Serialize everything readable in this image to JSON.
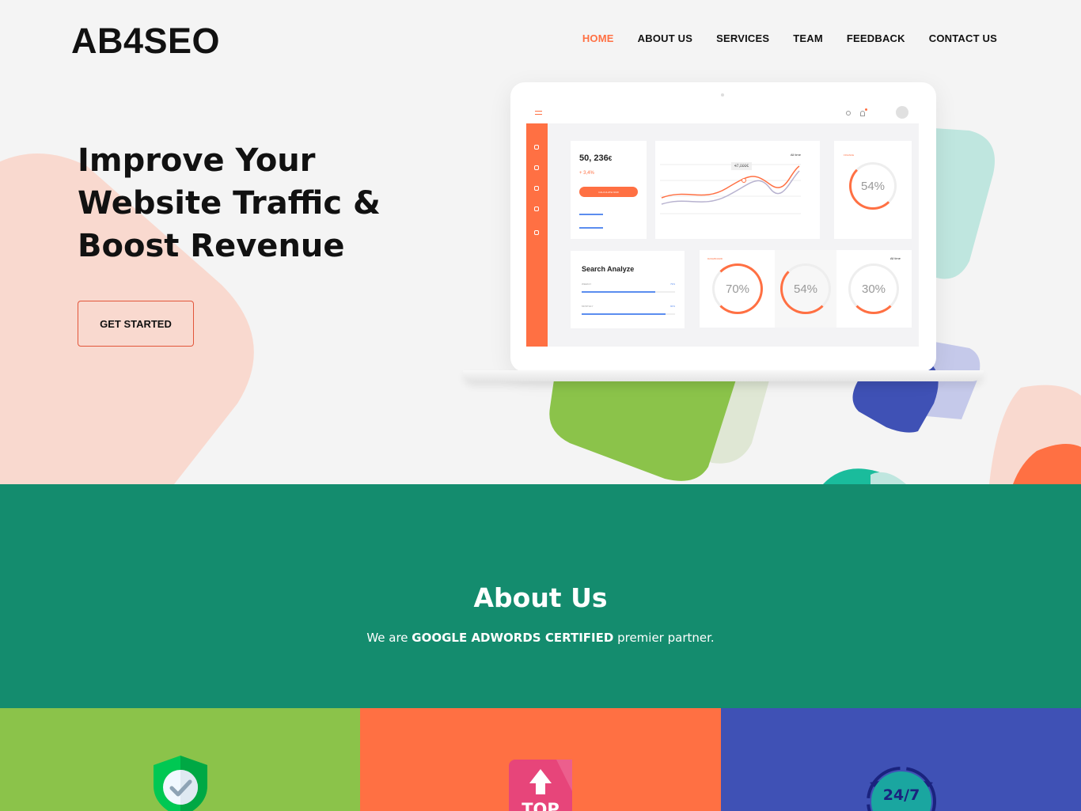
{
  "brand": {
    "logo": "AB4SEO"
  },
  "nav": {
    "items": [
      {
        "label": "HOME",
        "active": true
      },
      {
        "label": "ABOUT US",
        "active": false
      },
      {
        "label": "SERVICES",
        "active": false
      },
      {
        "label": "TEAM",
        "active": false
      },
      {
        "label": "FEEDBACK",
        "active": false
      },
      {
        "label": "CONTACT US",
        "active": false
      }
    ]
  },
  "hero": {
    "headline_lines": [
      "Improve Your",
      "Website Traffic &",
      "Boost Revenue"
    ],
    "cta_label": "GET STARTED"
  },
  "dashboard": {
    "revenue_value": "50, 236",
    "revenue_currency": "€",
    "revenue_change": "+ 3,4%",
    "calc_button": "CALCULATE NOW",
    "chart_tooltip": "47,000€",
    "chart_filter": "All time",
    "finance_label": "FINANCE",
    "finance_percent": "54%",
    "search_title": "Search Analyze",
    "weekly_label": "WEEKLY",
    "weekly_value": "79%",
    "monthly_label": "MONTHLY",
    "monthly_value": "90%",
    "rings_label": "DASHBOARD",
    "rings_filter": "All time",
    "rings": [
      "70%",
      "54%",
      "30%"
    ]
  },
  "about": {
    "title": "About Us",
    "text_prefix": "We are ",
    "text_bold": "GOOGLE ADWORDS CERTIFIED",
    "text_suffix": " premier partner."
  },
  "features": [
    {
      "color": "#8bc34a",
      "icon": "shield-check-icon"
    },
    {
      "color": "#ff7043",
      "icon": "top-arrow-icon",
      "icon_text": "TOP"
    },
    {
      "color": "#3f51b5",
      "icon": "support-24-7-icon",
      "icon_text": "24/7"
    }
  ],
  "colors": {
    "accent": "#ff7043",
    "about_bg": "#148c6e",
    "blob_pink": "#f9d9cf",
    "blob_green": "#8bc34a",
    "blob_mint": "#bfe6df",
    "blob_blue": "#3f51b5"
  }
}
